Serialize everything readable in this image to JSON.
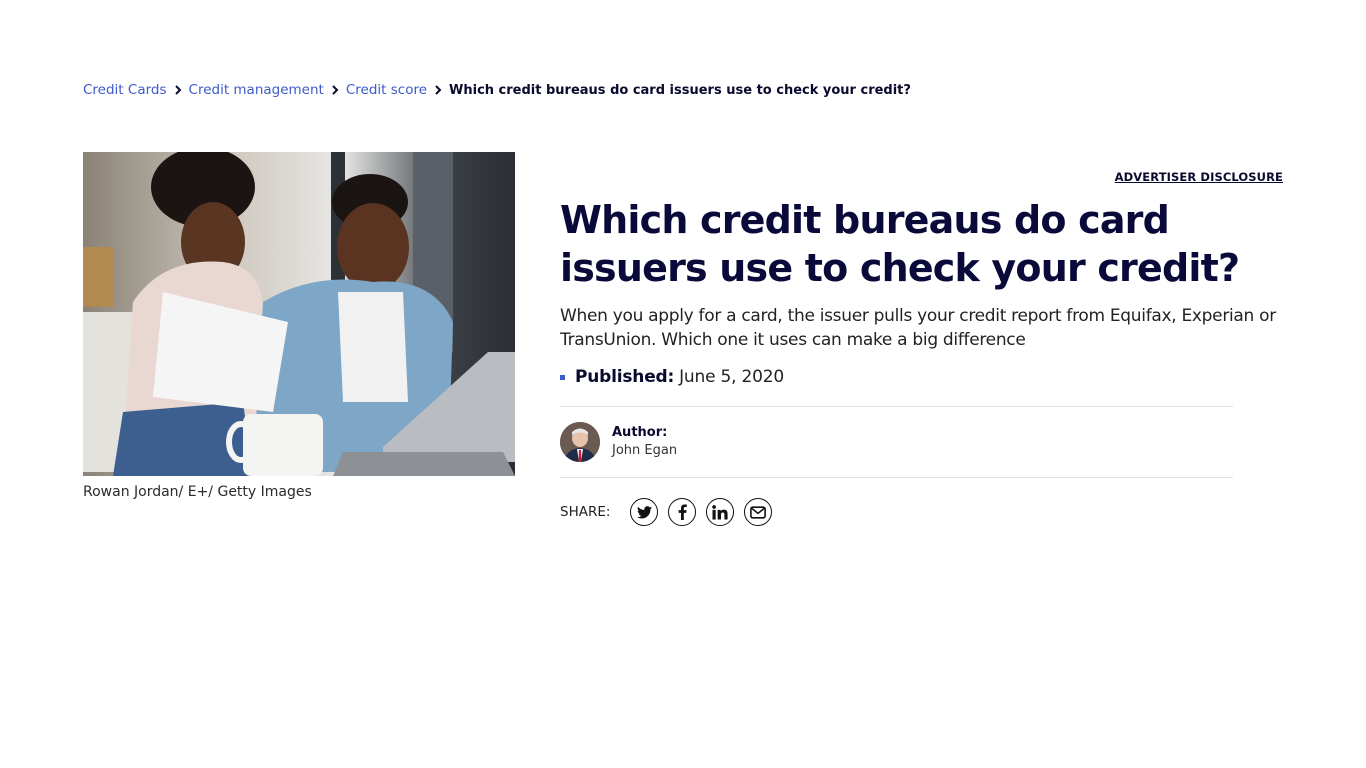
{
  "breadcrumb": {
    "items": [
      {
        "label": "Credit Cards"
      },
      {
        "label": "Credit management"
      },
      {
        "label": "Credit score"
      }
    ],
    "current": "Which credit bureaus do card issuers use to check your credit?"
  },
  "hero": {
    "image_alt": "Couple reviewing paperwork and a laptop on a couch",
    "caption": "Rowan Jordan/ E+/ Getty Images"
  },
  "article": {
    "advertiser_disclosure": "ADVERTISER DISCLOSURE",
    "title": "Which credit bureaus do card issuers use to check your credit?",
    "dek": "When you apply for a card, the issuer pulls your credit report from Equifax, Experian or TransUnion. Which one it uses can make a big difference",
    "published_label": "Published:",
    "published_date": "June 5, 2020",
    "author_label": "Author:",
    "author_name": "John Egan"
  },
  "share": {
    "label": "SHARE:",
    "buttons": [
      {
        "icon": "twitter-icon"
      },
      {
        "icon": "facebook-icon"
      },
      {
        "icon": "linkedin-icon"
      },
      {
        "icon": "email-icon"
      }
    ]
  },
  "colors": {
    "link": "#3d5acb",
    "heading": "#0a0a3a",
    "bullet": "#3d5acb"
  }
}
